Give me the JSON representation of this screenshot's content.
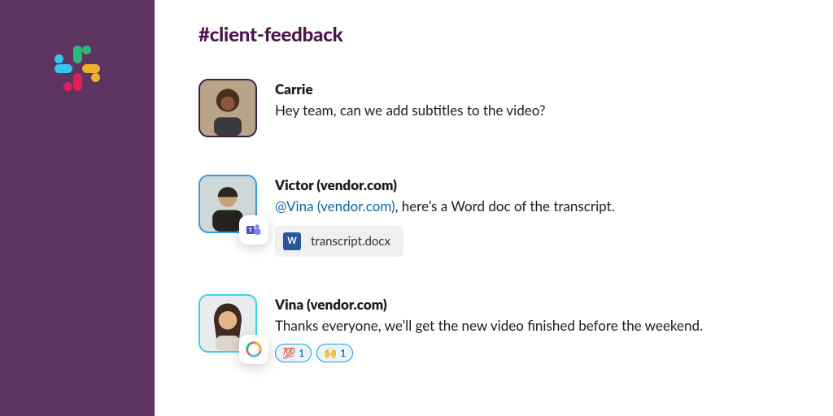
{
  "channel": {
    "name": "#client-feedback"
  },
  "messages": [
    {
      "sender": "Carrie",
      "text": "Hey team, can we add subtitles to the video?"
    },
    {
      "sender": "Victor (vendor.com)",
      "mention": "@Vina (vendor.com)",
      "text_after_mention": ", here’s a Word doc of the transcript.",
      "attachment": {
        "filename": "transcript.docx",
        "kind": "word"
      },
      "presence_app": "microsoft-teams"
    },
    {
      "sender": "Vina (vendor.com)",
      "text": "Thanks everyone, we’ll get the new video finished before the weekend.",
      "reactions": [
        {
          "emoji": "💯",
          "count": 1
        },
        {
          "emoji": "🙌",
          "count": 1
        }
      ],
      "presence_app": "color-ring"
    }
  ]
}
